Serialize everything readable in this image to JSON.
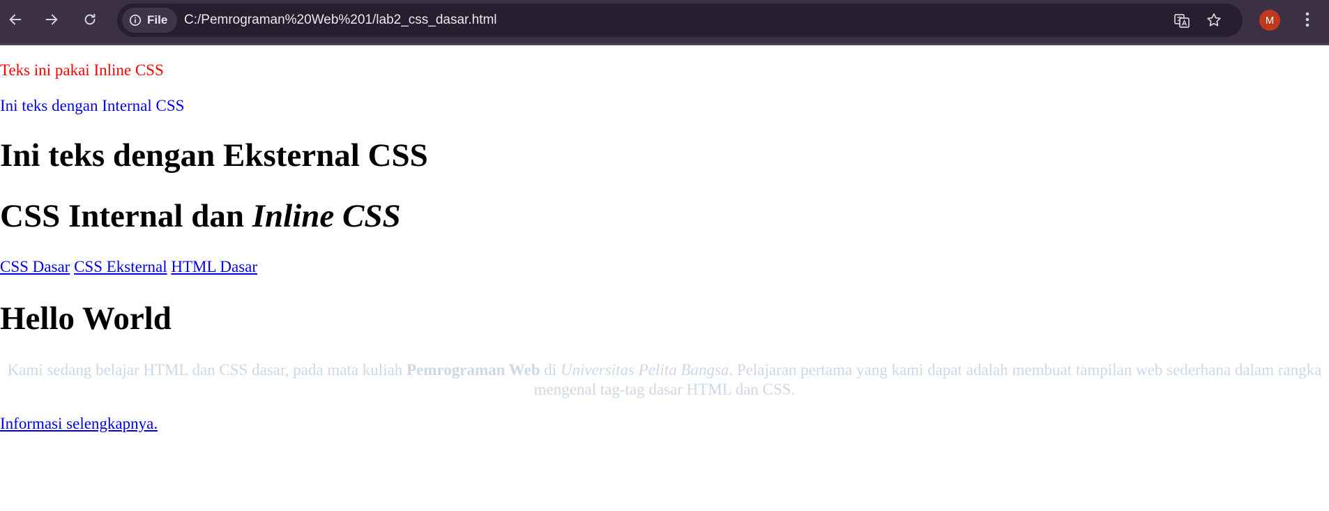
{
  "browser": {
    "site_chip_label": "File",
    "url": "C:/Pemrograman%20Web%201/lab2_css_dasar.html",
    "profile_initial": "M",
    "icons": {
      "back": "arrow-left-icon",
      "forward": "arrow-right-icon",
      "reload": "reload-icon",
      "info": "info-icon",
      "translate": "translate-icon",
      "bookmark": "star-icon",
      "menu": "kebab-menu-icon"
    },
    "colors": {
      "toolbar": "#3b3046",
      "omnibox": "#271f30",
      "avatar": "#c0391b"
    }
  },
  "page": {
    "inline_css_text": "Teks ini pakai Inline CSS",
    "internal_css_text": "Ini teks dengan Internal CSS",
    "external_css_heading": "Ini teks dengan Eksternal CSS",
    "internal_inline_heading": {
      "normal": "CSS Internal dan ",
      "italic": "Inline CSS"
    },
    "nav_links": [
      {
        "label": "CSS Dasar"
      },
      {
        "label": "CSS Eksternal"
      },
      {
        "label": "HTML Dasar"
      }
    ],
    "hello_heading": "Hello World",
    "intro": {
      "part1": "Kami sedang belajar HTML dan CSS dasar, pada mata kuliah ",
      "bold": "Pemrograman Web",
      "part2": " di ",
      "italic": "Universitas Pelita Bangsa",
      "part3": ". Pelajaran pertama yang kami dapat adalah membuat tampilan web sederhana dalam rangka mengenal tag-tag dasar HTML dan CSS."
    },
    "more_link": "Informasi selengkapnya.",
    "colors": {
      "inline_text": "#ff0000",
      "internal_text": "#0000ff",
      "link": "#0000ee",
      "intro_text": "#cdd8e7"
    }
  }
}
